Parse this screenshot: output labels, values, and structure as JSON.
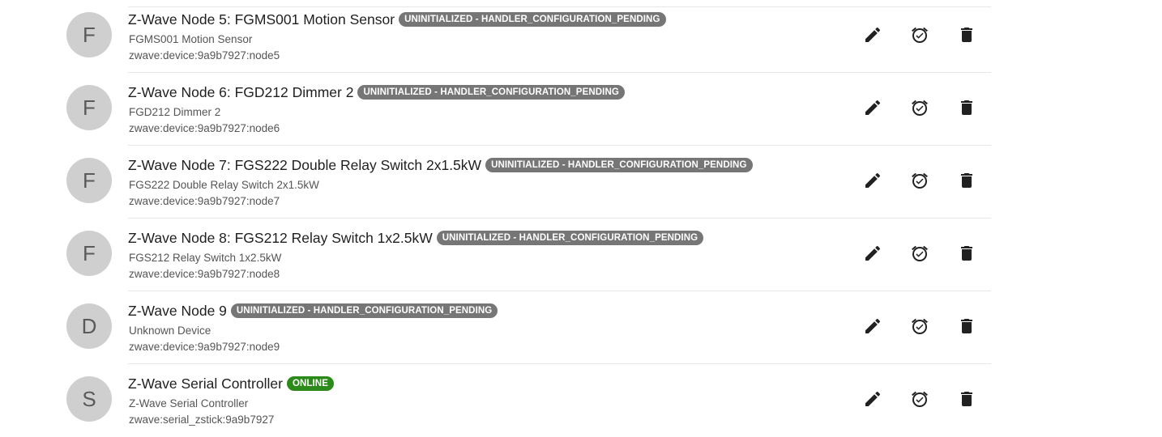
{
  "things": [
    {
      "avatar_letter": "F",
      "title": "Z-Wave Node 5: FGMS001 Motion Sensor",
      "status": "UNINITIALIZED - HANDLER_CONFIGURATION_PENDING",
      "status_color": "#767676",
      "label": "FGMS001 Motion Sensor",
      "uid": "zwave:device:9a9b7927:node5"
    },
    {
      "avatar_letter": "F",
      "title": "Z-Wave Node 6: FGD212 Dimmer 2",
      "status": "UNINITIALIZED - HANDLER_CONFIGURATION_PENDING",
      "status_color": "#767676",
      "label": "FGD212 Dimmer 2",
      "uid": "zwave:device:9a9b7927:node6"
    },
    {
      "avatar_letter": "F",
      "title": "Z-Wave Node 7: FGS222 Double Relay Switch 2x1.5kW",
      "status": "UNINITIALIZED - HANDLER_CONFIGURATION_PENDING",
      "status_color": "#767676",
      "label": "FGS222 Double Relay Switch 2x1.5kW",
      "uid": "zwave:device:9a9b7927:node7"
    },
    {
      "avatar_letter": "F",
      "title": "Z-Wave Node 8: FGS212 Relay Switch 1x2.5kW",
      "status": "UNINITIALIZED - HANDLER_CONFIGURATION_PENDING",
      "status_color": "#767676",
      "label": "FGS212 Relay Switch 1x2.5kW",
      "uid": "zwave:device:9a9b7927:node8"
    },
    {
      "avatar_letter": "D",
      "title": "Z-Wave Node 9",
      "status": "UNINITIALIZED - HANDLER_CONFIGURATION_PENDING",
      "status_color": "#767676",
      "label": "Unknown Device",
      "uid": "zwave:device:9a9b7927:node9"
    },
    {
      "avatar_letter": "S",
      "title": "Z-Wave Serial Controller",
      "status": "ONLINE",
      "status_color": "#2b8a1a",
      "label": "Z-Wave Serial Controller",
      "uid": "zwave:serial_zstick:9a9b7927"
    }
  ],
  "actions": {
    "edit_icon": "pencil-icon",
    "alarm_icon": "alarm-check-icon",
    "delete_icon": "trash-icon"
  }
}
